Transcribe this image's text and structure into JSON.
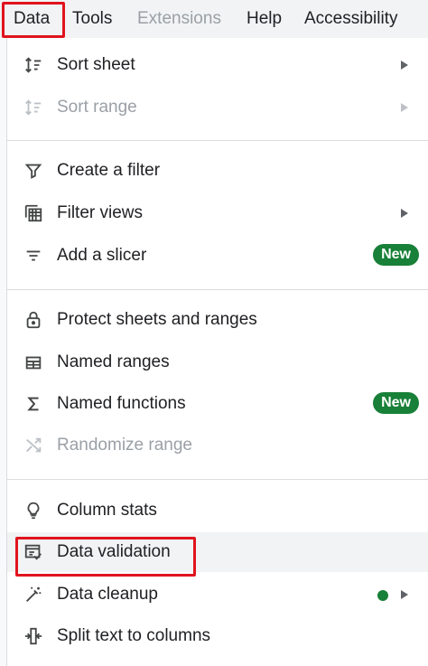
{
  "menubar": {
    "items": [
      {
        "label": "Data"
      },
      {
        "label": "Tools"
      },
      {
        "label": "Extensions"
      },
      {
        "label": "Help"
      },
      {
        "label": "Accessibility"
      }
    ]
  },
  "menu": {
    "sort_sheet": {
      "label": "Sort sheet"
    },
    "sort_range": {
      "label": "Sort range"
    },
    "create_filter": {
      "label": "Create a filter"
    },
    "filter_views": {
      "label": "Filter views"
    },
    "add_slicer": {
      "label": "Add a slicer",
      "badge": "New"
    },
    "protect": {
      "label": "Protect sheets and ranges"
    },
    "named_ranges": {
      "label": "Named ranges"
    },
    "named_functions": {
      "label": "Named functions",
      "badge": "New"
    },
    "randomize": {
      "label": "Randomize range"
    },
    "column_stats": {
      "label": "Column stats"
    },
    "data_validation": {
      "label": "Data validation"
    },
    "data_cleanup": {
      "label": "Data cleanup"
    },
    "split_text": {
      "label": "Split text to columns"
    }
  },
  "colors": {
    "highlight": "#e0141e",
    "badge": "#188038",
    "hover": "#f1f3f4"
  }
}
